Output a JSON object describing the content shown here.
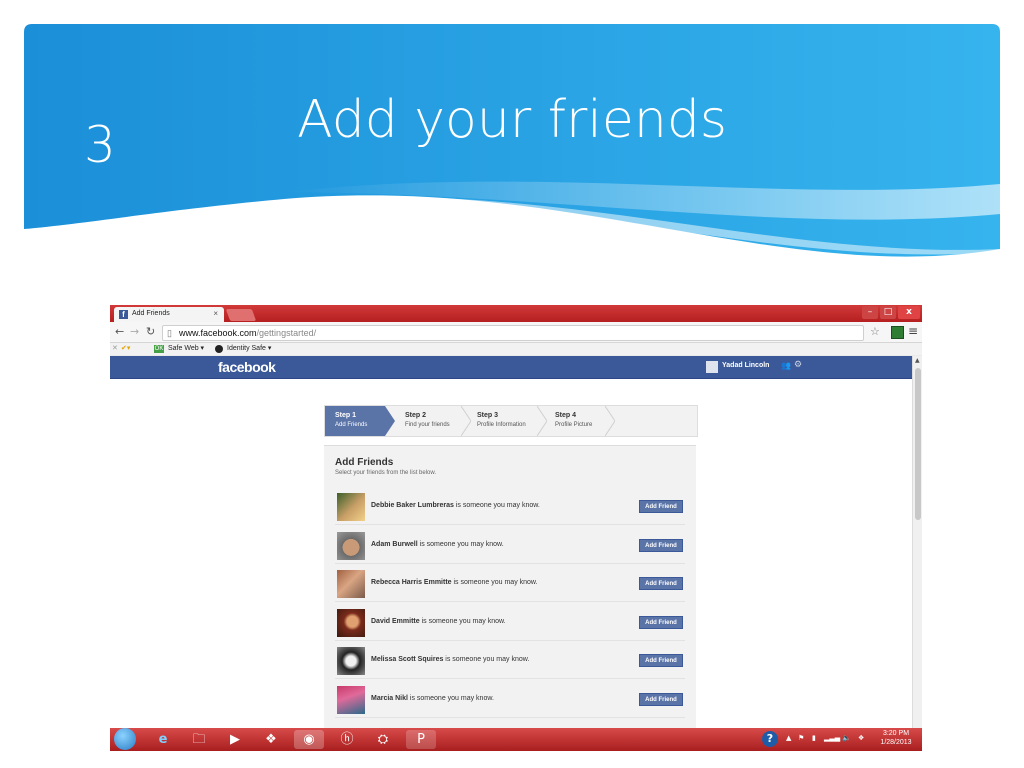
{
  "slide": {
    "number": "3",
    "title": "Add your friends"
  },
  "browser": {
    "tab_title": "Add Friends",
    "tab_close": "×",
    "window_controls": {
      "minimize": "–",
      "maximize": "□",
      "close": "x"
    },
    "url_host": "www.facebook.com",
    "url_path": "/gettingstarted/",
    "bookmarks": {
      "safe_web": "Safe Web ▾",
      "identity_safe": "Identity Safe ▾"
    }
  },
  "facebook": {
    "logo": "facebook",
    "user_name": "Yadad Lincoln",
    "steps": [
      {
        "title": "Step 1",
        "subtitle": "Add Friends"
      },
      {
        "title": "Step 2",
        "subtitle": "Find your friends"
      },
      {
        "title": "Step 3",
        "subtitle": "Profile Information"
      },
      {
        "title": "Step 4",
        "subtitle": "Profile Picture"
      }
    ],
    "panel_title": "Add Friends",
    "panel_subtitle": "Select your friends from the list below.",
    "suggestion_suffix": " is someone you may know.",
    "add_friend_label": "Add Friend",
    "friends": [
      {
        "name": "Debbie Baker Lumbreras"
      },
      {
        "name": "Adam Burwell"
      },
      {
        "name": "Rebecca Harris Emmitte"
      },
      {
        "name": "David Emmitte"
      },
      {
        "name": "Melissa Scott Squires"
      },
      {
        "name": "Marcia Nikl"
      }
    ]
  },
  "taskbar": {
    "time": "3:20 PM",
    "date": "1/28/2013"
  },
  "colors": {
    "header_blue": "#1a9be0",
    "facebook_blue": "#3b5998",
    "browser_red": "#c0292b"
  }
}
